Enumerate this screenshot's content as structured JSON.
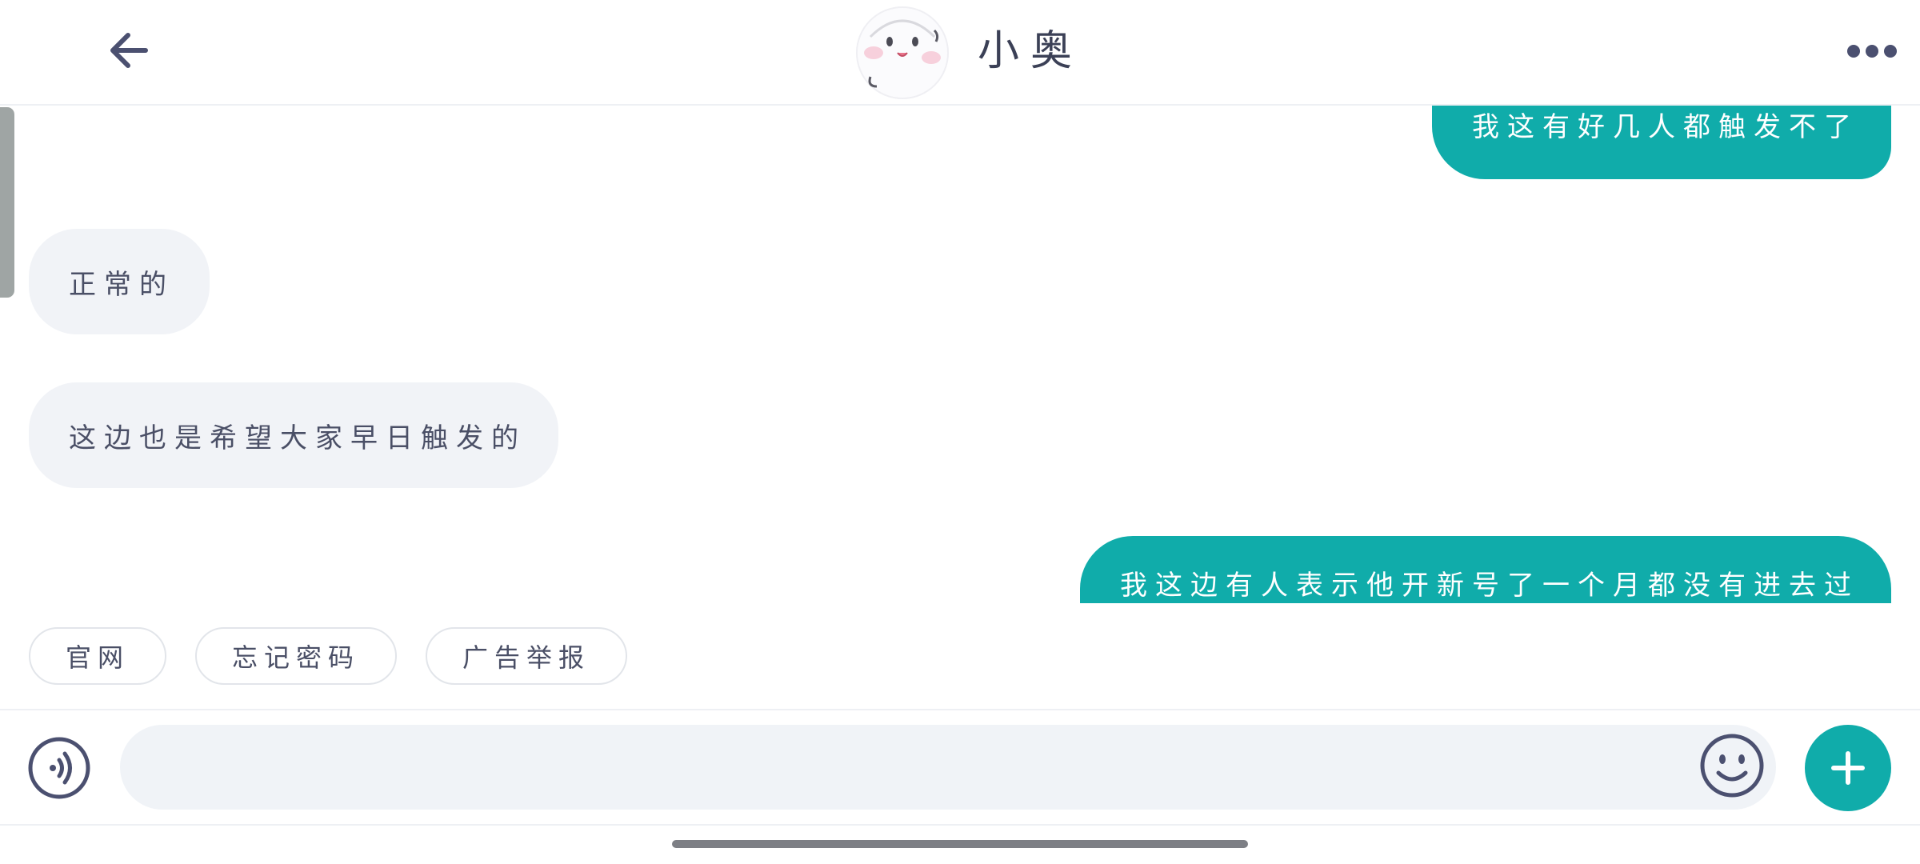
{
  "header": {
    "title": "小奥",
    "back_icon": "arrow-left-icon",
    "more_icon": "more-horizontal-icon",
    "avatar_icon": "cute-face-avatar"
  },
  "messages": [
    {
      "direction": "out",
      "text": "我这有好几人都触发不了"
    },
    {
      "direction": "in",
      "text": "正常的"
    },
    {
      "direction": "in",
      "text": "这边也是希望大家早日触发的"
    },
    {
      "direction": "out",
      "text": "我这边有人表示他开新号了一个月都没有进去过"
    }
  ],
  "quick_replies": [
    "官网",
    "忘记密码",
    "广告举报"
  ],
  "input": {
    "value": "",
    "placeholder": "",
    "voice_icon": "voice-input-icon",
    "emoji_icon": "emoji-smile-icon",
    "plus_icon": "plus-icon"
  },
  "colors": {
    "accent": "#10acaa",
    "incoming_bubble": "#f1f3f7",
    "text": "#3f4458"
  }
}
